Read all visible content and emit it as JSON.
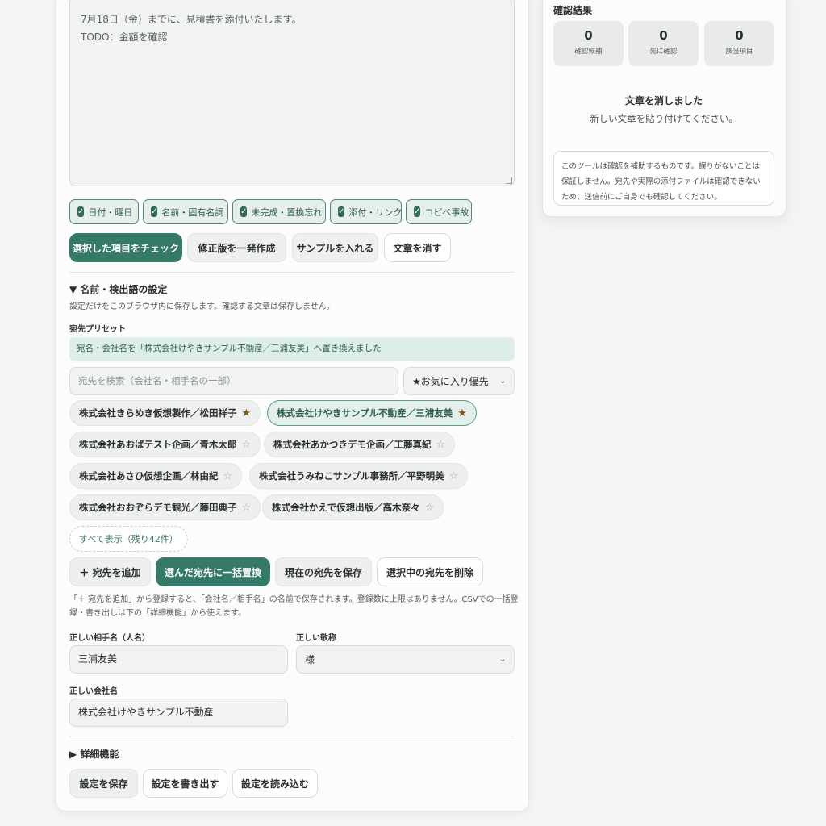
{
  "editor": {
    "lines": [
      "7月18日（金）までに、見積書を添付いたします。",
      "TODO：金額を確認"
    ]
  },
  "checks": [
    {
      "label": "日付・曜日",
      "checked": true
    },
    {
      "label": "名前・固有名詞",
      "checked": true
    },
    {
      "label": "未完成・置換忘れ",
      "checked": true
    },
    {
      "label": "添付・リンク",
      "checked": true
    },
    {
      "label": "コピペ事故",
      "checked": true
    }
  ],
  "actions": {
    "check_selected": "選択した項目をチェック",
    "make_revision": "修正版を一発作成",
    "insert_sample": "サンプルを入れる",
    "clear_text": "文章を消す"
  },
  "settings": {
    "summary": "▼ 名前・検出語の設定",
    "note": "設定だけをこのブラウザ内に保存します。確認する文章は保存しません。",
    "preset_label": "宛先プリセット",
    "banner": "宛名・会社名を「株式会社けやきサンプル不動産／三浦友美」へ置き換えました",
    "search_placeholder": "宛先を検索（会社名・相手名の一部）",
    "sort_value": "★お気に入り優先",
    "presets": [
      {
        "label": "株式会社きらめき仮想製作／松田祥子",
        "star": "★",
        "fav": true,
        "selected": false
      },
      {
        "label": "株式会社けやきサンプル不動産／三浦友美",
        "star": "★",
        "fav": true,
        "selected": true
      },
      {
        "label": "株式会社あおばテスト企画／青木太郎",
        "star": "☆",
        "fav": false,
        "selected": false
      },
      {
        "label": "株式会社あかつきデモ企画／工藤真紀",
        "star": "☆",
        "fav": false,
        "selected": false
      },
      {
        "label": "株式会社あさひ仮想企画／林由紀",
        "star": "☆",
        "fav": false,
        "selected": false
      },
      {
        "label": "株式会社うみねこサンプル事務所／平野明美",
        "star": "☆",
        "fav": false,
        "selected": false
      },
      {
        "label": "株式会社おおぞらデモ観光／藤田典子",
        "star": "☆",
        "fav": false,
        "selected": false
      },
      {
        "label": "株式会社かえで仮想出版／高木奈々",
        "star": "☆",
        "fav": false,
        "selected": false
      }
    ],
    "show_all": "すべて表示（残り42件）",
    "add_recipient": "＋ 宛先を追加",
    "bulk_replace": "選んだ宛先に一括置換",
    "save_current": "現在の宛先を保存",
    "delete_selected": "選択中の宛先を削除",
    "help_line1": "「＋ 宛先を追加」から登録すると、「会社名／相手名」の名前で保存されます。登録数に上限はありません。CSVでの一括登",
    "help_line2": "録・書き出しは下の「詳細機能」から使えます。",
    "name_label": "正しい相手名（人名）",
    "name_value": "三浦友美",
    "honorific_label": "正しい敬称",
    "honorific_value": "様",
    "company_label": "正しい会社名",
    "company_value": "株式会社けやきサンプル不動産",
    "advanced_summary": "▶ 詳細機能",
    "save_settings": "設定を保存",
    "export_settings": "設定を書き出す",
    "import_settings": "設定を読み込む"
  },
  "results": {
    "title": "確認結果",
    "stats": [
      {
        "value": "0",
        "label": "確認候補"
      },
      {
        "value": "0",
        "label": "先に確認"
      },
      {
        "value": "0",
        "label": "該当項目"
      }
    ],
    "empty_title": "文章を消しました",
    "empty_sub": "新しい文章を貼り付けてください。",
    "disclaimer": "このツールは確認を補助するものです。誤りがないことは保証しません。宛先や実際の添付ファイルは確認できないため、送信前にご自身でも確認してください。"
  },
  "colors": {
    "accent": "#357a69",
    "background": "#f3f4f3",
    "card": "#fbfcfb"
  }
}
